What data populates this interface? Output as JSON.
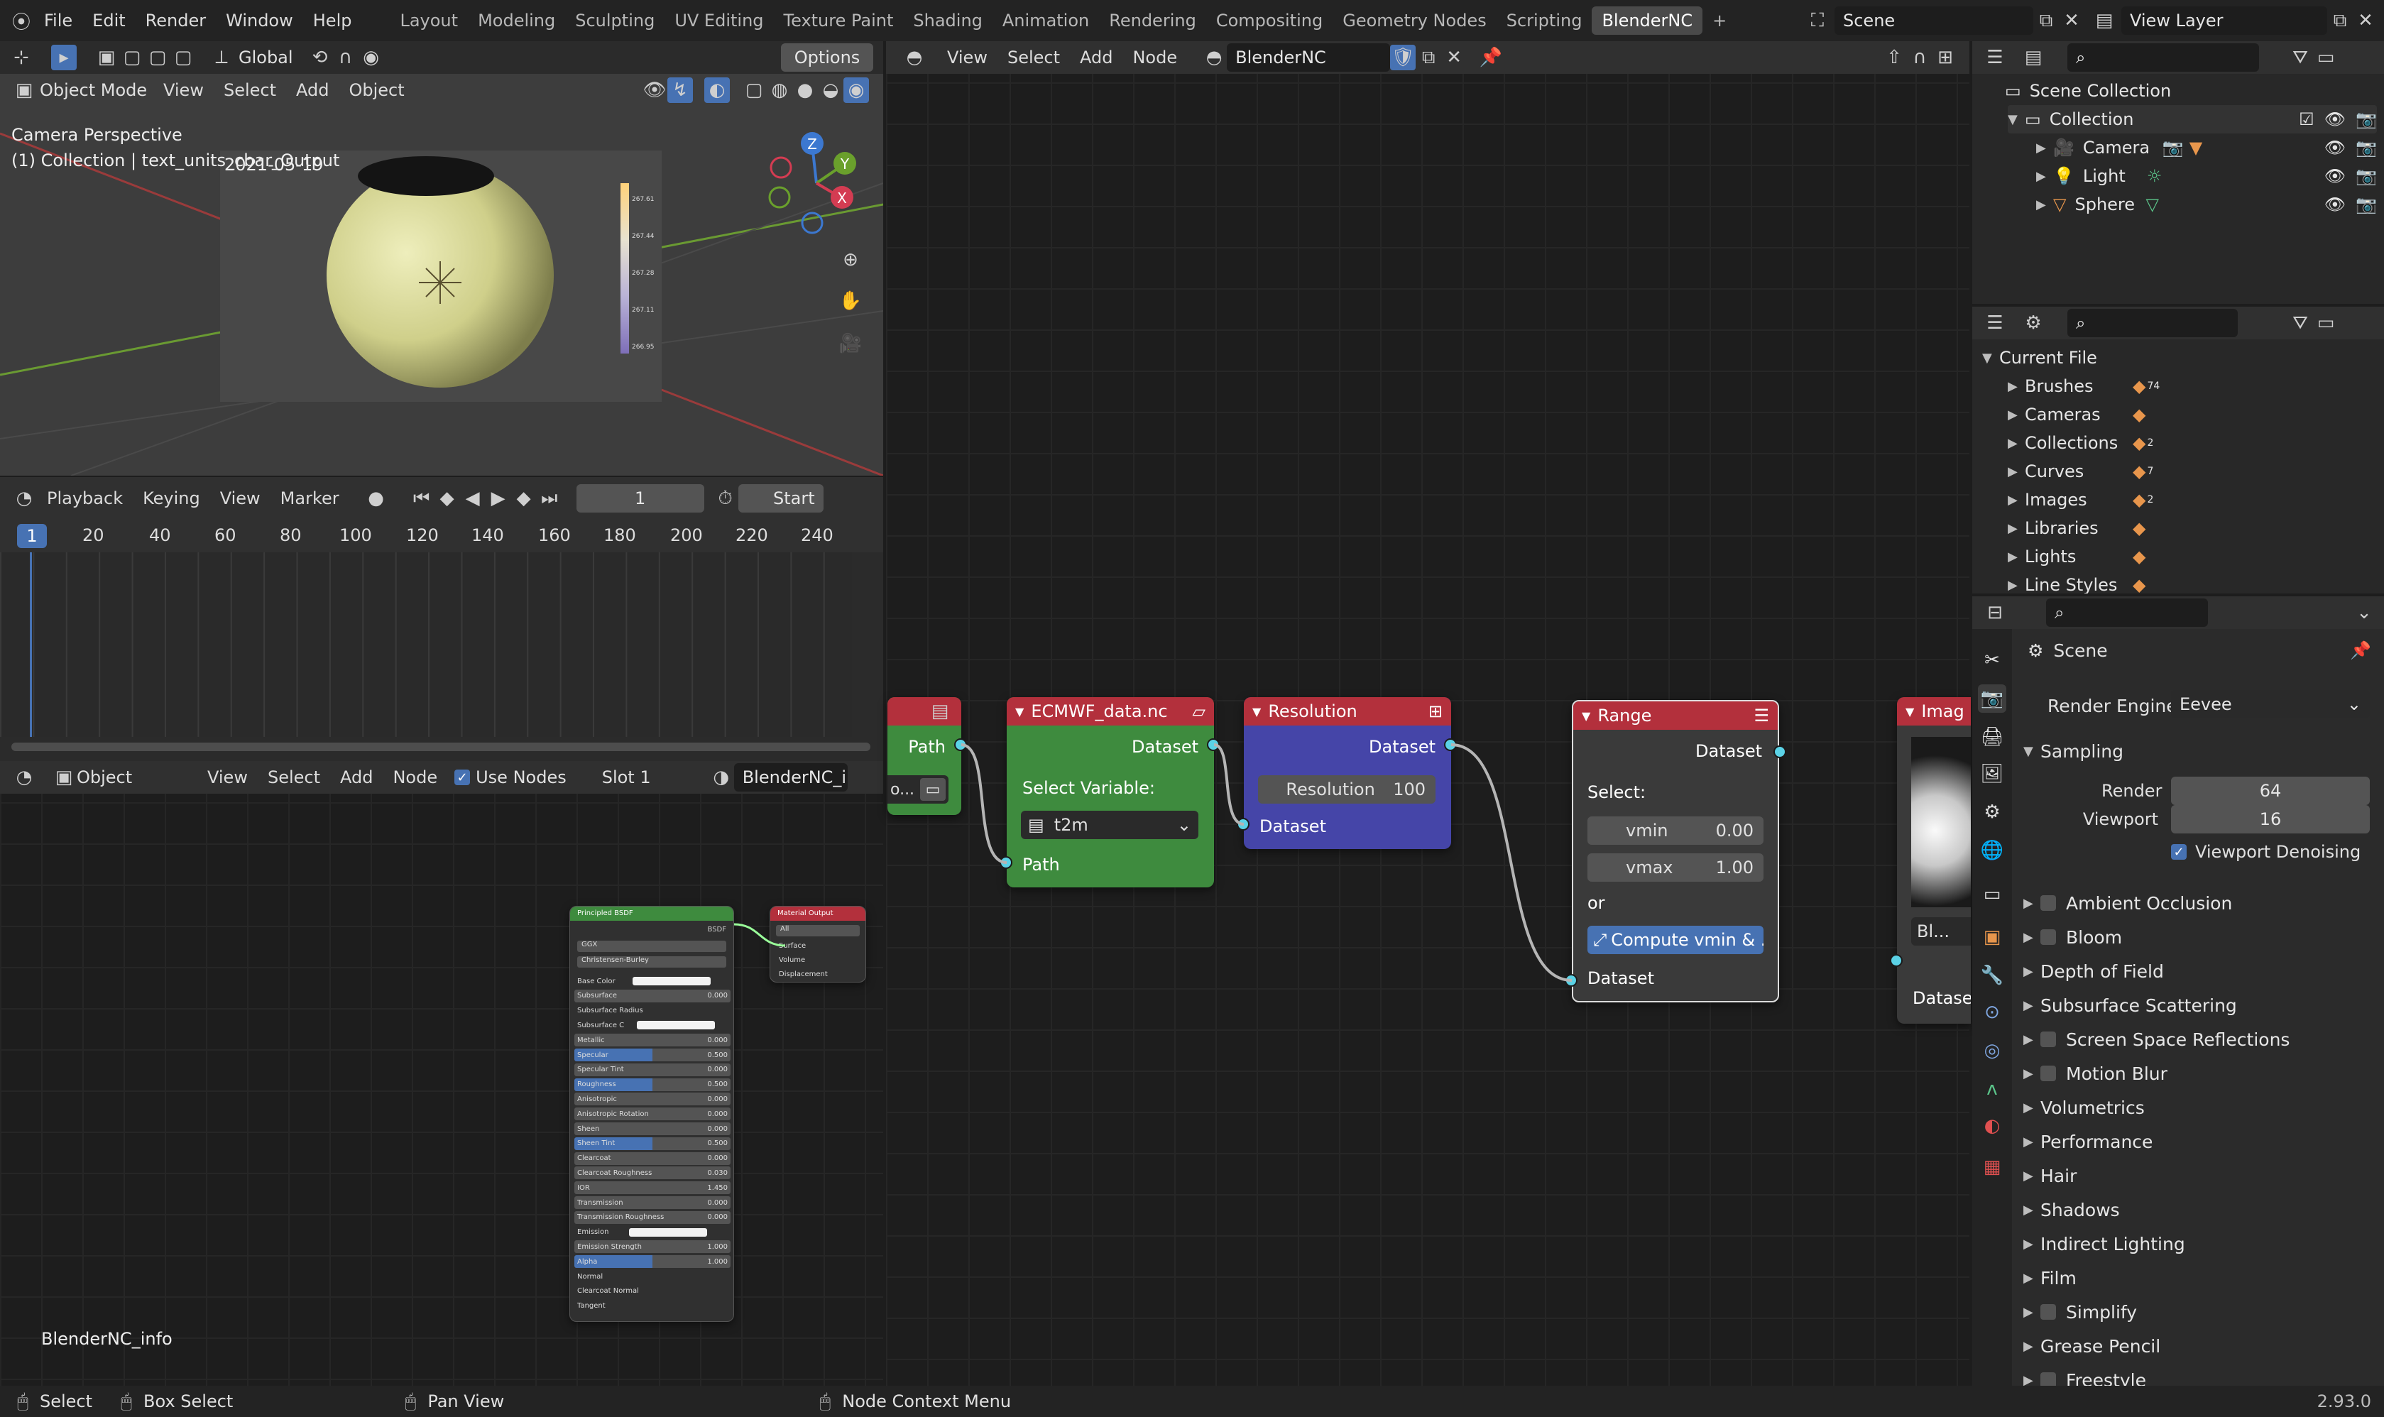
{
  "topbar": {
    "menus": [
      "File",
      "Edit",
      "Render",
      "Window",
      "Help"
    ],
    "workspaces": [
      "Layout",
      "Modeling",
      "Sculpting",
      "UV Editing",
      "Texture Paint",
      "Shading",
      "Animation",
      "Rendering",
      "Compositing",
      "Geometry Nodes",
      "Scripting",
      "BlenderNC"
    ],
    "active_workspace": "BlenderNC",
    "add_tab": "+",
    "scene_name": "Scene",
    "view_layer": "View Layer"
  },
  "viewport": {
    "transform_orientation": "Global",
    "options_label": "Options",
    "mode": "Object Mode",
    "menus": [
      "View",
      "Select",
      "Add",
      "Object"
    ],
    "camera_text": "Camera Perspective",
    "collection_text": "(1) Collection | text_units_cbar_Output",
    "date_text": "2021-05-19",
    "legend_ticks": [
      "267.61",
      "267.44",
      "267.28",
      "267.11",
      "266.95"
    ],
    "axis_labels": {
      "z": "Z",
      "y": "Y",
      "x": "X"
    }
  },
  "timeline": {
    "menus": [
      "Playback",
      "Keying",
      "View",
      "Marker"
    ],
    "current_frame": "1",
    "start_label": "Start",
    "ruler": [
      "1",
      "20",
      "40",
      "60",
      "80",
      "100",
      "120",
      "140",
      "160",
      "180",
      "200",
      "220",
      "240"
    ]
  },
  "shader_editor": {
    "object_label": "Object",
    "menus": [
      "View",
      "Select",
      "Add",
      "Node"
    ],
    "use_nodes_label": "Use Nodes",
    "slot_label": "Slot 1",
    "material_name": "BlenderNC_info",
    "material_label": "BlenderNC_info",
    "principled": {
      "title": "Principled BSDF",
      "output": "BSDF",
      "dist": "GGX",
      "sss": "Christensen-Burley",
      "rows": [
        {
          "label": "Base Color",
          "value": ""
        },
        {
          "label": "Subsurface",
          "value": "0.000"
        },
        {
          "label": "Subsurface Radius",
          "value": ""
        },
        {
          "label": "Subsurface C",
          "value": ""
        },
        {
          "label": "Metallic",
          "value": "0.000"
        },
        {
          "label": "Specular",
          "value": "0.500"
        },
        {
          "label": "Specular Tint",
          "value": "0.000"
        },
        {
          "label": "Roughness",
          "value": "0.500"
        },
        {
          "label": "Anisotropic",
          "value": "0.000"
        },
        {
          "label": "Anisotropic Rotation",
          "value": "0.000"
        },
        {
          "label": "Sheen",
          "value": "0.000"
        },
        {
          "label": "Sheen Tint",
          "value": "0.500"
        },
        {
          "label": "Clearcoat",
          "value": "0.000"
        },
        {
          "label": "Clearcoat Roughness",
          "value": "0.030"
        },
        {
          "label": "IOR",
          "value": "1.450"
        },
        {
          "label": "Transmission",
          "value": "0.000"
        },
        {
          "label": "Transmission Roughness",
          "value": "0.000"
        },
        {
          "label": "Emission",
          "value": ""
        },
        {
          "label": "Emission Strength",
          "value": "1.000"
        },
        {
          "label": "Alpha",
          "value": "1.000"
        },
        {
          "label": "Normal",
          "value": ""
        },
        {
          "label": "Clearcoat Normal",
          "value": ""
        },
        {
          "label": "Tangent",
          "value": ""
        }
      ]
    },
    "mat_output": {
      "title": "Material Output",
      "target": "All",
      "inputs": [
        "Surface",
        "Volume",
        "Displacement"
      ]
    }
  },
  "node_editor": {
    "menus": [
      "View",
      "Select",
      "Add",
      "Node"
    ],
    "tree_name": "BlenderNC",
    "path_node": {
      "output": "Path",
      "field": "o..."
    },
    "ecmwf_node": {
      "title": "ECMWF_data.nc",
      "output": "Dataset",
      "select_label": "Select Variable:",
      "variable": "t2m",
      "input": "Path"
    },
    "resolution_node": {
      "title": "Resolution",
      "output": "Dataset",
      "field_label": "Resolution",
      "field_value": "100",
      "input": "Dataset"
    },
    "range_node": {
      "title": "Range",
      "output": "Dataset",
      "select_label": "Select:",
      "vmin_label": "vmin",
      "vmin_value": "0.00",
      "vmax_label": "vmax",
      "vmax_value": "1.00",
      "or_label": "or",
      "compute_label": "Compute vmin & ...",
      "input": "Dataset"
    },
    "image_node": {
      "title": "Imag",
      "field": "Bl...",
      "input": "Dataset"
    }
  },
  "outliner": {
    "root": "Scene Collection",
    "collection": "Collection",
    "items": [
      "Camera",
      "Light",
      "Sphere"
    ]
  },
  "data_browser": {
    "root": "Current File",
    "items": [
      {
        "label": "Brushes",
        "count": "74"
      },
      {
        "label": "Cameras",
        "count": ""
      },
      {
        "label": "Collections",
        "count": "2"
      },
      {
        "label": "Curves",
        "count": "7"
      },
      {
        "label": "Images",
        "count": "2"
      },
      {
        "label": "Libraries",
        "count": ""
      },
      {
        "label": "Lights",
        "count": ""
      },
      {
        "label": "Line Styles",
        "count": ""
      }
    ]
  },
  "properties": {
    "scene_label": "Scene",
    "render_engine_label": "Render Engine",
    "render_engine_value": "Eevee",
    "sampling_label": "Sampling",
    "render_label": "Render",
    "render_value": "64",
    "viewport_label": "Viewport",
    "viewport_value": "16",
    "denoise_label": "Viewport Denoising",
    "panels": [
      {
        "label": "Ambient Occlusion",
        "checkbox": true
      },
      {
        "label": "Bloom",
        "checkbox": true
      },
      {
        "label": "Depth of Field",
        "checkbox": false
      },
      {
        "label": "Subsurface Scattering",
        "checkbox": false
      },
      {
        "label": "Screen Space Reflections",
        "checkbox": true
      },
      {
        "label": "Motion Blur",
        "checkbox": true
      },
      {
        "label": "Volumetrics",
        "checkbox": false
      },
      {
        "label": "Performance",
        "checkbox": false
      },
      {
        "label": "Hair",
        "checkbox": false
      },
      {
        "label": "Shadows",
        "checkbox": false
      },
      {
        "label": "Indirect Lighting",
        "checkbox": false
      },
      {
        "label": "Film",
        "checkbox": false
      },
      {
        "label": "Simplify",
        "checkbox": true
      },
      {
        "label": "Grease Pencil",
        "checkbox": false
      },
      {
        "label": "Freestyle",
        "checkbox": true
      }
    ]
  },
  "statusbar": {
    "select": "Select",
    "box_select": "Box Select",
    "pan_view": "Pan View",
    "context_menu": "Node Context Menu",
    "version": "2.93.0"
  },
  "colors": {
    "accent_blue": "#4772b3",
    "node_green": "#3e8b3e",
    "node_red": "#b3303c",
    "node_blue": "#4545a8",
    "socket_cyan": "#5bd2e6"
  }
}
